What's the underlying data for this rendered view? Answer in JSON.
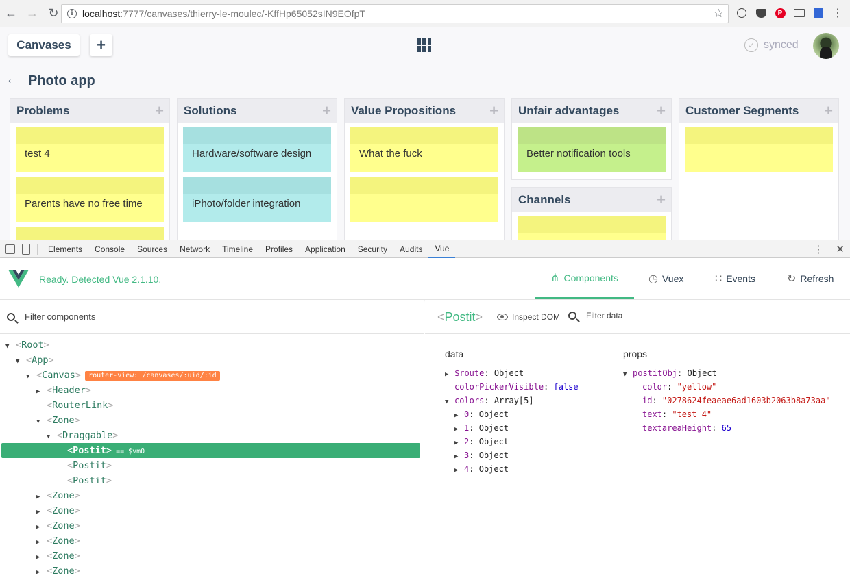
{
  "browser": {
    "url_host": "localhost",
    "url_path": ":7777/canvases/thierry-le-moulec/-KffHp65052sIN9EOfpT"
  },
  "app": {
    "canvases_label": "Canvases",
    "add_label": "+",
    "sync_status": "synced",
    "page_title": "Photo app"
  },
  "board": {
    "columns": [
      {
        "title": "Problems",
        "postits": [
          {
            "text": "test 4",
            "color": "yellow"
          },
          {
            "text": "Parents have no free time",
            "color": "yellow"
          },
          {
            "text": "",
            "color": "yellow"
          }
        ]
      },
      {
        "title": "Solutions",
        "postits": [
          {
            "text": "Hardware/software design",
            "color": "blue"
          },
          {
            "text": "iPhoto/folder integration",
            "color": "blue"
          }
        ]
      },
      {
        "title": "Value Propositions",
        "postits": [
          {
            "text": "What the fuck",
            "color": "yellow"
          },
          {
            "text": "",
            "color": "yellow"
          }
        ]
      },
      {
        "title": "Unfair advantages",
        "postits": [
          {
            "text": "Better notification tools",
            "color": "green"
          }
        ]
      },
      {
        "title": "Channels",
        "postits": [
          {
            "text": "",
            "color": "yellow"
          }
        ]
      },
      {
        "title": "Customer Segments",
        "postits": [
          {
            "text": "",
            "color": "yellow"
          }
        ]
      }
    ]
  },
  "devtools": {
    "tabs": [
      "Elements",
      "Console",
      "Sources",
      "Network",
      "Timeline",
      "Profiles",
      "Application",
      "Security",
      "Audits",
      "Vue"
    ],
    "active_tab": "Vue"
  },
  "vue": {
    "status": "Ready. Detected Vue 2.1.10.",
    "tabs": [
      {
        "label": "Components",
        "icon": "components-icon"
      },
      {
        "label": "Vuex",
        "icon": "history-icon"
      },
      {
        "label": "Events",
        "icon": "events-icon"
      },
      {
        "label": "Refresh",
        "icon": "refresh-icon"
      }
    ],
    "filter_components_placeholder": "Filter components",
    "tree": [
      {
        "name": "Root",
        "expanded": true
      },
      {
        "name": "App",
        "expanded": true
      },
      {
        "name": "Canvas",
        "expanded": true,
        "badge": "router-view: /canvases/:uid/:id"
      },
      {
        "name": "Header",
        "expanded": false
      },
      {
        "name": "RouterLink"
      },
      {
        "name": "Zone",
        "expanded": true
      },
      {
        "name": "Draggable",
        "expanded": true
      },
      {
        "name": "Postit",
        "selected": true,
        "vm": "== $vm0"
      },
      {
        "name": "Postit"
      },
      {
        "name": "Postit"
      },
      {
        "name": "Zone",
        "expanded": false
      },
      {
        "name": "Zone",
        "expanded": false
      },
      {
        "name": "Zone",
        "expanded": false
      },
      {
        "name": "Zone",
        "expanded": false
      },
      {
        "name": "Zone",
        "expanded": false
      },
      {
        "name": "Zone",
        "expanded": false
      }
    ],
    "inspector": {
      "component": "Postit",
      "inspect_dom_label": "Inspect DOM",
      "filter_data_placeholder": "Filter data",
      "data_title": "data",
      "props_title": "props",
      "data": [
        {
          "key": "$route",
          "value": "Object",
          "toggle": "collapsed"
        },
        {
          "key": "colorPickerVisible",
          "value": "false"
        },
        {
          "key": "colors",
          "value": "Array[5]",
          "toggle": "expanded"
        },
        {
          "key": "0",
          "value": "Object",
          "toggle": "collapsed"
        },
        {
          "key": "1",
          "value": "Object",
          "toggle": "collapsed"
        },
        {
          "key": "2",
          "value": "Object",
          "toggle": "collapsed"
        },
        {
          "key": "3",
          "value": "Object",
          "toggle": "collapsed"
        },
        {
          "key": "4",
          "value": "Object",
          "toggle": "collapsed"
        }
      ],
      "props": [
        {
          "key": "postitObj",
          "value": "Object",
          "toggle": "expanded"
        },
        {
          "key": "color",
          "value": "\"yellow\""
        },
        {
          "key": "id",
          "value": "\"0278624feaeae6ad1603b2063b8a73aa\""
        },
        {
          "key": "text",
          "value": "\"test 4\""
        },
        {
          "key": "textareaHeight",
          "value": "65"
        }
      ]
    }
  },
  "colors": {
    "vue_green": "#42b983",
    "selected_row": "#3aae76",
    "badge": "#ff8344",
    "postit_yellow": "#ffff8d",
    "postit_blue": "#b2ebeb",
    "postit_green": "#c5f08c"
  }
}
